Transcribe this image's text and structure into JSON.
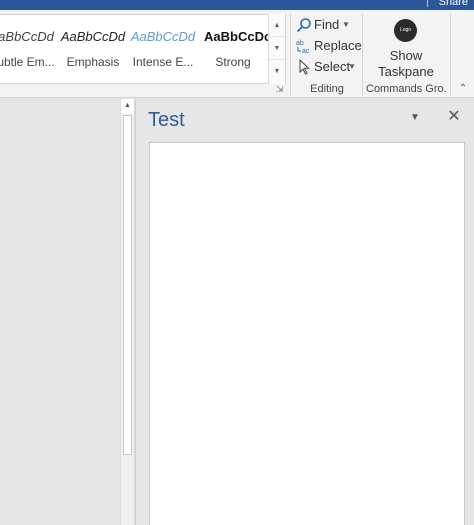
{
  "titlebar": {
    "share_label": "Share"
  },
  "styles_gallery": {
    "items": [
      {
        "sample": "aBbCcDd",
        "name": "ubtle Em..."
      },
      {
        "sample": "AaBbCcDd",
        "name": "Emphasis"
      },
      {
        "sample": "AaBbCcDd",
        "name": "Intense E..."
      },
      {
        "sample": "AaBbCcDc",
        "name": "Strong"
      }
    ]
  },
  "editing": {
    "find_label": "Find",
    "replace_label": "Replace",
    "select_label": "Select",
    "group_label": "Editing"
  },
  "commands": {
    "logo_text": "Logo",
    "show_label_line1": "Show",
    "show_label_line2": "Taskpane",
    "group_label": "Commands Gro..."
  },
  "taskpane": {
    "title": "Test"
  },
  "colors": {
    "titlebar": "#2b579a",
    "taskpane_title": "#2e5e9a",
    "intense_emphasis": "#5b9bd5"
  }
}
